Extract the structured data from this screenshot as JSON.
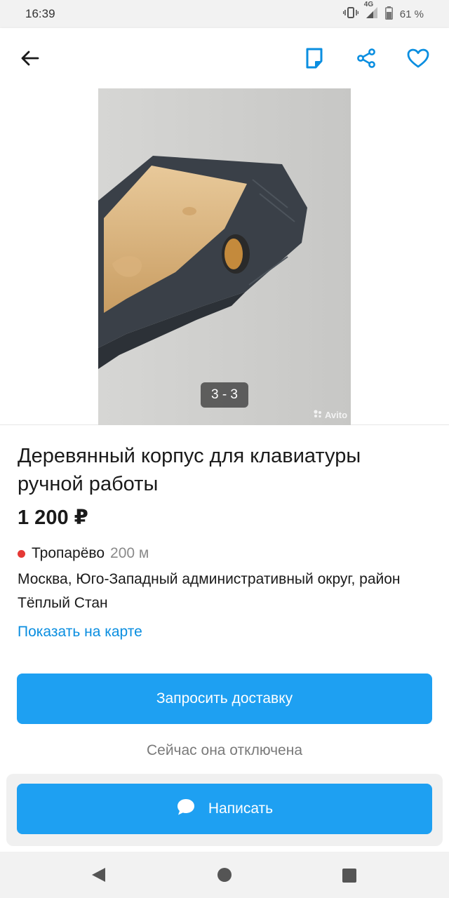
{
  "status_bar": {
    "time": "16:39",
    "network": "4G",
    "battery": "61 %"
  },
  "gallery": {
    "page_indicator": "3 - 3",
    "watermark": "Avito"
  },
  "listing": {
    "title": "Деревянный корпус для клавиатуры ручной работы",
    "price": "1 200 ₽",
    "metro_station": "Тропарёво",
    "metro_distance": "200 м",
    "metro_color": "#e53935",
    "address": "Москва, Юго-Западный административный округ, район Тёплый Стан",
    "map_link": "Показать на карте"
  },
  "actions": {
    "delivery_button": "Запросить доставку",
    "delivery_note": "Сейчас она отключена",
    "write_button": "Написать"
  },
  "colors": {
    "accent": "#1ea0f2",
    "link": "#0a8ee0"
  }
}
